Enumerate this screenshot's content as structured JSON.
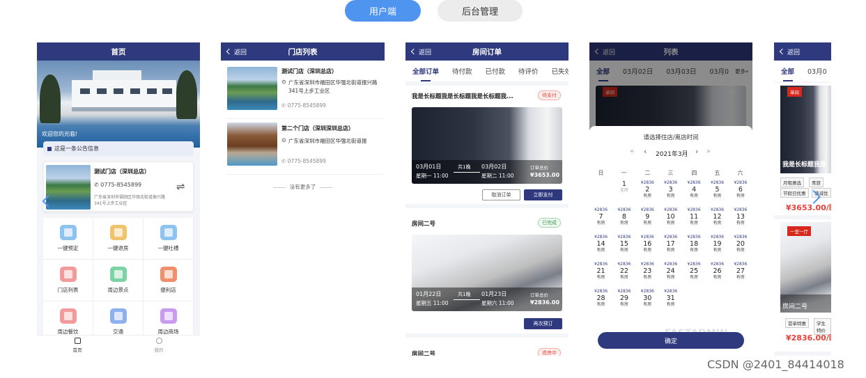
{
  "mode_switch": {
    "user_side": "用户端",
    "admin_side": "后台管理"
  },
  "screen1": {
    "title": "首页",
    "welcome": "欢迎您的光临!",
    "notice": "这是一条公告信息",
    "store": {
      "name": "测试门店（深圳总店）",
      "phone": "0775-8545899",
      "address": "广东省深圳市福田区华强北街道振兴路341号上步工业区"
    },
    "grid": [
      "一键预定",
      "一键退房",
      "一键吐槽",
      "门店列表",
      "周边景点",
      "便利店",
      "周边餐饮",
      "交通",
      "周边商场"
    ],
    "tabbar": {
      "home": "首页",
      "mine": "我的"
    }
  },
  "screen2": {
    "back": "返回",
    "title": "门店列表",
    "stores": [
      {
        "name": "测试门店（深圳总店）",
        "address": "广东省深圳市福田区华强北街道振兴路341号上步工业区",
        "phone": "0775-8545899"
      },
      {
        "name": "第二个门店（深圳深圳总店）",
        "address": "广东省深圳市福田区华强北街道振",
        "phone": "0775-8545899"
      }
    ],
    "no_more": "没有更多了"
  },
  "screen3": {
    "back": "返回",
    "title": "房间订单",
    "tabs": [
      "全部订单",
      "待付款",
      "已付款",
      "待评价",
      "已失效"
    ],
    "orders": [
      {
        "title": "我是长标题我是长标题我是长标题我...",
        "status": "待支付",
        "checkin_date": "03月01日",
        "checkin_time": "星期一 11:00",
        "nights": "共1晚",
        "checkout_date": "03月02日",
        "checkout_time": "星期二 11:00",
        "total_label": "订单总价",
        "total": "¥3653.00",
        "btn1": "取消订单",
        "btn2": "立即支付"
      },
      {
        "title": "房间二号",
        "status": "已完成",
        "checkin_date": "01月22日",
        "checkin_time": "星期五 11:00",
        "nights": "共1晚",
        "checkout_date": "01月23日",
        "checkout_time": "星期六 11:00",
        "total_label": "订单总价",
        "total": "¥2836.00",
        "btn2": "再次预订"
      },
      {
        "title": "房间二号",
        "status": "退房中"
      }
    ]
  },
  "screen4": {
    "back": "返回",
    "title": "列表",
    "tabs": [
      "全部",
      "03月02日",
      "03月03日",
      "03月0",
      "更多»"
    ],
    "badge": "单间",
    "sheet_title": "请选择住店/离店时间",
    "month": "2021年3月",
    "nav": {
      "prev_year": "«",
      "prev": "‹",
      "next": "›",
      "next_year": "»"
    },
    "weekdays": [
      "日",
      "一",
      "二",
      "三",
      "四",
      "五",
      "六"
    ],
    "price": "¥2836",
    "avail": "有房",
    "full": "无房",
    "days": [
      1,
      2,
      3,
      4,
      5,
      6,
      7,
      8,
      9,
      10,
      11,
      12,
      13,
      14,
      15,
      16,
      17,
      18,
      19,
      20,
      21,
      22,
      23,
      24,
      25,
      26,
      27,
      28,
      29,
      30,
      31
    ],
    "confirm": "确定",
    "watermark": "FASTADMIN"
  },
  "screen5": {
    "back": "返回",
    "tabs": [
      "全部",
      "03月0"
    ],
    "badge1": "单间",
    "room1_title": "我是长标题我是",
    "tags1": [
      "月租惠选",
      "青旅",
      "节假日优惠",
      "满减优"
    ],
    "price1": "¥3653.00/晚",
    "badge2": "一室一厅",
    "room2_title": "房间二号",
    "tags2": [
      "首单特惠",
      "学生特价"
    ],
    "price2": "¥2836.00/晚"
  },
  "watermark": "CSDN @2401_84414018"
}
